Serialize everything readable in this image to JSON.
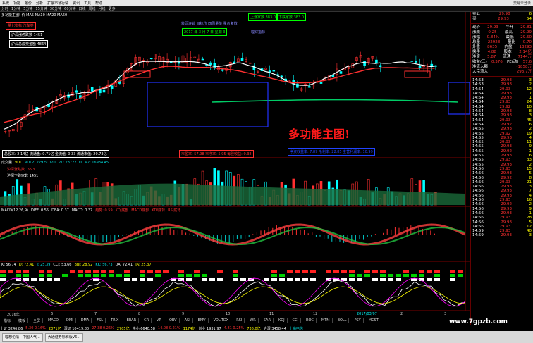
{
  "menu": [
    "系统",
    "功能",
    "报价",
    "分析",
    "扩展市场行情",
    "资讯",
    "工具",
    "帮助"
  ],
  "window_title": "交易未登录",
  "toolbar": [
    "分时",
    "1分钟",
    "5分钟",
    "15分钟",
    "30分钟",
    "60分钟",
    "日线",
    "周线",
    "月线",
    "更多"
  ],
  "main_legend": "多功能主图! 价 MA5 MA10 MA20 MA60",
  "top_left_boxes": [
    {
      "text": "量化指标  汽车类",
      "color": "#ff3030"
    },
    {
      "text": "沪深涨停跌数 1451",
      "color": "#ffffff"
    },
    {
      "text": "沪深总成交金额 4864",
      "color": "#ffffff"
    }
  ],
  "date_box": {
    "text": "2017 年 3 月 7 日   星期 3",
    "color": "#00ff00"
  },
  "top_right_boxes": [
    {
      "text": "上涨家数 383.0",
      "color": "#00ff00"
    },
    {
      "text": "下跌家数 383.0",
      "color": "#00ff00"
    }
  ],
  "mid_info": "筹码连锁  目标位  四周量能  量价复数",
  "mid_info2": "理财指标",
  "big_title": "多功能主图!",
  "bottom_boxes": [
    {
      "text": "总股本: 2.14亿  流通盘: 0.71亿  金流值: 0.33  流通市值: 20.73亿",
      "color": "#ffffff"
    },
    {
      "text": "市盈率: 57.98  市净率: 5.95  每股收益: 0.38",
      "color": "#ff3030"
    },
    {
      "text": "净资收益率: 7.89  毛利率: 22.85  主营利润率: 10.99",
      "color": "#2244ff"
    }
  ],
  "volume_legend": [
    "成交量",
    "VOL",
    "VOL2: 22929.070",
    "V1: 23722.00",
    "V2: 16984.45"
  ],
  "volume_boxes": [
    {
      "text": "沪深涨跌数 1993",
      "color": "#ff3030"
    },
    {
      "text": "沪深下跌家数 1451",
      "color": "#ffffff"
    }
  ],
  "macd_legend": [
    "MACD(12,26,9)",
    "DIFF: 0.55",
    "DEA: 0.37",
    "MACD: 0.37",
    "趋势: 0.59",
    "KDJ底部",
    "MACD底部",
    "KD/底背",
    "RSI底背"
  ],
  "kdj_legend": [
    "K: 56.74",
    "D: 72.41",
    "J: 25.39",
    "CCI: 53.66",
    "BBI: 28.92",
    "KK: 56.73",
    "DA: 72.41",
    "JA: 25.37"
  ],
  "date_axis": [
    "2016年",
    "6",
    "7",
    "8",
    "9",
    "10",
    "11",
    "12",
    "2017/03/07",
    "2",
    "3"
  ],
  "axis_labels_price": [
    "35.12",
    "32.50",
    "30.00",
    "27.50",
    "25.00",
    "22.50",
    "20.00"
  ],
  "right_panel": {
    "header": [
      {
        "label": "卖五",
        "value": "29.98",
        "vol": "6"
      },
      {
        "label": "买一",
        "value": "29.93",
        "vol": "54"
      }
    ],
    "quote": [
      {
        "label": "现价",
        "value": "29.93",
        "label2": "今开",
        "value2": "29.81"
      },
      {
        "label": "涨跌",
        "value": "0.25",
        "label2": "最高",
        "value2": "29.99"
      },
      {
        "label": "涨幅",
        "value": "0.84%",
        "label2": "最低",
        "value2": "29.50"
      },
      {
        "label": "总量",
        "value": "22928",
        "label2": "量比",
        "value2": "0.70"
      },
      {
        "label": "外盘",
        "value": "8635",
        "label2": "内盘",
        "value2": "13293"
      },
      {
        "label": "换手",
        "value": "4.88",
        "label2": "股本",
        "value2": "2.14亿"
      },
      {
        "label": "净资",
        "value": "5.87",
        "label2": "流通",
        "value2": "7144万"
      },
      {
        "label": "收益(三)",
        "value": "0.376",
        "label2": "PE(动)",
        "value2": "57.6"
      }
    ],
    "flow": [
      {
        "label": "净流入额",
        "value": "-1858万"
      },
      {
        "label": "大宗流入",
        "value": "293.7万"
      }
    ],
    "ticks": [
      {
        "time": "14:53",
        "price": "29.93",
        "vol": "3"
      },
      {
        "time": "14:53",
        "price": "29.93",
        "vol": "2"
      },
      {
        "time": "14:54",
        "price": "29.93",
        "vol": "12"
      },
      {
        "time": "14:54",
        "price": "29.93",
        "vol": "7"
      },
      {
        "time": "14:54",
        "price": "29.93",
        "vol": "1"
      },
      {
        "time": "14:54",
        "price": "29.93",
        "vol": "24"
      },
      {
        "time": "14:54",
        "price": "29.92",
        "vol": "10"
      },
      {
        "time": "14:54",
        "price": "29.93",
        "vol": "8"
      },
      {
        "time": "14:54",
        "price": "29.93",
        "vol": "3"
      },
      {
        "time": "14:54",
        "price": "29.93",
        "vol": "45"
      },
      {
        "time": "14:54",
        "price": "29.92",
        "vol": "6"
      },
      {
        "time": "14:55",
        "price": "29.93",
        "vol": "2"
      },
      {
        "time": "14:55",
        "price": "29.92",
        "vol": "19"
      },
      {
        "time": "14:55",
        "price": "29.93",
        "vol": "4"
      },
      {
        "time": "14:55",
        "price": "29.93",
        "vol": "11"
      },
      {
        "time": "14:55",
        "price": "29.93",
        "vol": "9"
      },
      {
        "time": "14:55",
        "price": "29.92",
        "vol": "1"
      },
      {
        "time": "14:55",
        "price": "29.93",
        "vol": "6"
      },
      {
        "time": "14:55",
        "price": "29.93",
        "vol": "33"
      },
      {
        "time": "14:55",
        "price": "29.93",
        "vol": "2"
      },
      {
        "time": "14:56",
        "price": "29.93",
        "vol": "15"
      },
      {
        "time": "14:56",
        "price": "29.93",
        "vol": "5"
      },
      {
        "time": "14:56",
        "price": "29.92",
        "vol": "8"
      },
      {
        "time": "14:56",
        "price": "29.93",
        "vol": "21"
      },
      {
        "time": "14:56",
        "price": "29.93",
        "vol": "3"
      },
      {
        "time": "14:56",
        "price": "29.93",
        "vol": "7"
      },
      {
        "time": "14:56",
        "price": "29.93",
        "vol": "4"
      },
      {
        "time": "14:56",
        "price": "29.93",
        "vol": "16"
      },
      {
        "time": "14:56",
        "price": "29.92",
        "vol": "2"
      },
      {
        "time": "14:56",
        "price": "29.93",
        "vol": "9"
      },
      {
        "time": "14:56",
        "price": "29.93",
        "vol": "1"
      },
      {
        "time": "14:56",
        "price": "29.93",
        "vol": "28"
      },
      {
        "time": "14:56",
        "price": "29.93",
        "vol": "5"
      },
      {
        "time": "14:56",
        "price": "29.93",
        "vol": "12"
      },
      {
        "time": "14:59",
        "price": "29.93",
        "vol": "40"
      },
      {
        "time": "14:59",
        "price": "29.93",
        "vol": "3"
      }
    ]
  },
  "bottom_tabs": [
    "指标",
    "模板",
    "全屏",
    "MACD",
    "DMI",
    "DMA",
    "FSL",
    "TRIX",
    "BRAR",
    "CR",
    "VR",
    "OBV",
    "ASI",
    "EMV",
    "VOL-TDX",
    "RSI",
    "WR",
    "SAR",
    "KDJ",
    "CCI",
    "ROC",
    "MTM",
    "BOLL",
    "PSY",
    "MCST"
  ],
  "status": [
    {
      "text": "上证 3246.86",
      "color": "#ffffff"
    },
    {
      "text": "5.30  0.16%",
      "color": "#ff3030"
    },
    {
      "text": "2071亿",
      "color": "#ffff00"
    },
    {
      "text": "深证 10419.80",
      "color": "#ffffff"
    },
    {
      "text": "27.38  0.26%",
      "color": "#ff3030"
    },
    {
      "text": "2705亿",
      "color": "#ffff00"
    },
    {
      "text": "中小 6640.58",
      "color": "#ffffff"
    },
    {
      "text": "14.08  0.21%",
      "color": "#ff3030"
    },
    {
      "text": "1174亿",
      "color": "#ffff00"
    },
    {
      "text": "创业 1931.97",
      "color": "#ffffff"
    },
    {
      "text": "4.81  0.25%",
      "color": "#ff3030"
    },
    {
      "text": "736.0亿",
      "color": "#ffff00"
    },
    {
      "text": "沪深 3458.44",
      "color": "#ffffff"
    },
    {
      "text": "上海电信",
      "color": "#00e0e0"
    }
  ],
  "taskbar": [
    "理想论坛 - 中国人气...",
    "大通证券标准版V6..."
  ],
  "watermark": "www.7gpzb.com"
}
